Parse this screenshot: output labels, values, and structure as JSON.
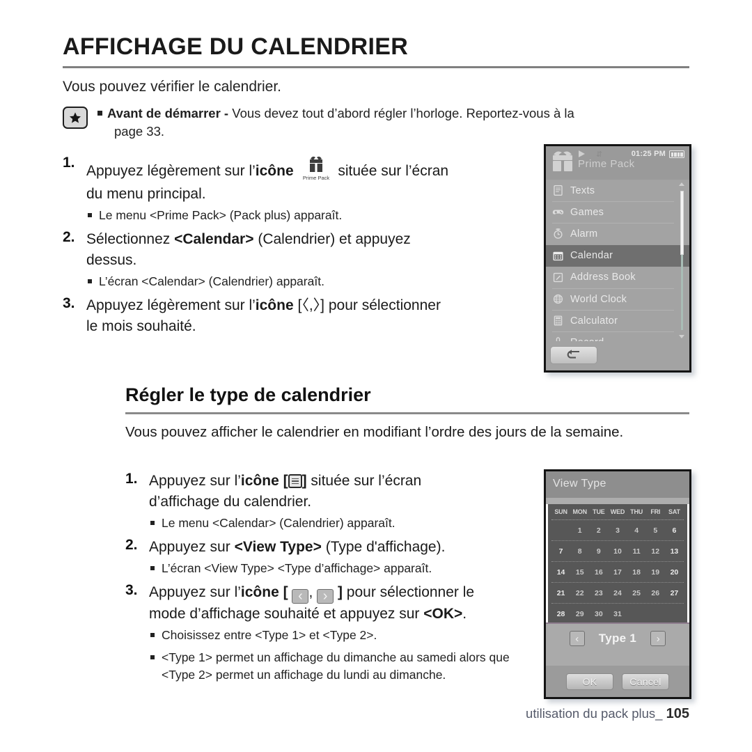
{
  "page": {
    "title": "AFFICHAGE DU CALENDRIER",
    "intro": "Vous pouvez vérifier le calendrier.",
    "footer_text": "utilisation du pack plus_",
    "page_number": "105"
  },
  "note": {
    "icon": "star-icon",
    "bold_lead": "Avant de démarrer -",
    "body": " Vous devez tout d’abord régler l’horloge. Reportez-vous à la",
    "continuation": "page 33."
  },
  "section1": {
    "steps": [
      {
        "num": "1.",
        "pre": "Appuyez légèrement sur l’",
        "bold": "icône",
        "icon_label": "Prime Pack",
        "post": "située sur l’écran",
        "line2": "du menu principal.",
        "subs": [
          "Le menu <Prime Pack> (Pack plus) apparaît."
        ]
      },
      {
        "num": "2.",
        "pre": "Sélectionnez ",
        "bold": "<Calendar>",
        "post": " (Calendrier) et appuyez",
        "line2": "dessus.",
        "subs": [
          "L’écran <Calendar> (Calendrier) apparaît."
        ]
      },
      {
        "num": "3.",
        "pre": "Appuyez légèrement sur l’",
        "bold": "icône",
        "post_bracket": "[〈,〉]",
        "post": " pour sélectionner",
        "line2": "le mois souhaité.",
        "subs": []
      }
    ]
  },
  "section2": {
    "title": "Régler le type de calendrier",
    "intro": "Vous pouvez afficher le calendrier en modifiant l’ordre des jours de la semaine.",
    "steps": [
      {
        "num": "1.",
        "pre": "Appuyez sur l’",
        "bold": "icône [",
        "icon": "list-menu-icon",
        "bold_close": "]",
        "post": " située sur l’écran",
        "line2": "d’affichage du calendrier.",
        "subs": [
          "Le menu <Calendar> (Calendrier) apparaît."
        ]
      },
      {
        "num": "2.",
        "pre": "Appuyez sur ",
        "bold": "<View Type>",
        "post": " (Type d'affichage).",
        "subs": [
          "L’écran <View Type> <Type d’affichage> apparaît."
        ]
      },
      {
        "num": "3.",
        "pre": "Appuyez sur l’",
        "bold": "icône [",
        "icon_left": "chevron-left-button",
        "sep": ",",
        "icon_right": "chevron-right-button",
        "bold_close": "]",
        "post": " pour sélectionner le",
        "line2_pre": "mode d’affichage souhaité et appuyez sur ",
        "line2_bold": "<OK>",
        "line2_post": ".",
        "subs": [
          "Choisissez entre <Type 1> et <Type 2>.",
          "<Type 1> permet un affichage du dimanche au samedi alors que <Type 2> permet un affichage du lundi au dimanche."
        ]
      }
    ]
  },
  "device_prime_pack": {
    "status": {
      "title": "Prime Pack",
      "time": "01:25 PM",
      "play_icon": "play-icon",
      "repeat_icon": "repeat-icon",
      "battery_icon": "battery-icon"
    },
    "menu_items": [
      {
        "label": "Texts",
        "icon": "document-icon",
        "selected": false
      },
      {
        "label": "Games",
        "icon": "gamepad-icon",
        "selected": false
      },
      {
        "label": "Alarm",
        "icon": "alarm-clock-icon",
        "selected": false
      },
      {
        "label": "Calendar",
        "icon": "calendar-icon",
        "selected": true
      },
      {
        "label": "Address Book",
        "icon": "address-book-icon",
        "selected": false
      },
      {
        "label": "World Clock",
        "icon": "globe-icon",
        "selected": false
      },
      {
        "label": "Calculator",
        "icon": "calculator-icon",
        "selected": false
      },
      {
        "label": "Record",
        "icon": "microphone-icon",
        "selected": false
      }
    ],
    "back_button": "back-arrow-icon"
  },
  "device_view_type": {
    "title": "View Type",
    "day_headers": [
      "SUN",
      "MON",
      "TUE",
      "WED",
      "THU",
      "FRI",
      "SAT"
    ],
    "weeks": [
      [
        "",
        "1",
        "2",
        "3",
        "4",
        "5",
        "6"
      ],
      [
        "7",
        "8",
        "9",
        "10",
        "11",
        "12",
        "13"
      ],
      [
        "14",
        "15",
        "16",
        "17",
        "18",
        "19",
        "20"
      ],
      [
        "21",
        "22",
        "23",
        "24",
        "25",
        "26",
        "27"
      ],
      [
        "28",
        "29",
        "30",
        "31",
        "",
        "",
        ""
      ]
    ],
    "type_label": "Type 1",
    "prev_arrow": "‹",
    "next_arrow": "›",
    "ok_label": "OK",
    "cancel_label": "Cancel"
  },
  "colors": {
    "screen_bg": "#a3a3a3",
    "status_bar": "#9a9a9a",
    "selected_row": "#6f6f6f",
    "calendar_bg": "#575757",
    "frame": "#141414"
  }
}
